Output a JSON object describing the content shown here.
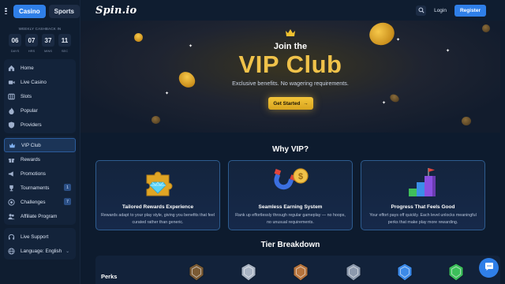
{
  "header": {
    "tabs": [
      {
        "label": "Casino",
        "active": true
      },
      {
        "label": "Sports",
        "active": false
      }
    ],
    "logo": "Spin.io",
    "login_label": "Login",
    "register_label": "Register"
  },
  "weekly_cashback": {
    "title": "WEEKLY CASHBACK IN",
    "values": [
      "06",
      "07",
      "37",
      "11"
    ],
    "labels": [
      "DAYS",
      "HRS",
      "MINS",
      "SEC"
    ]
  },
  "sidebar": {
    "group1": [
      {
        "label": "Home",
        "icon": "home-icon"
      },
      {
        "label": "Live Casino",
        "icon": "video-icon"
      },
      {
        "label": "Slots",
        "icon": "slots-icon"
      },
      {
        "label": "Popular",
        "icon": "flame-icon"
      },
      {
        "label": "Providers",
        "icon": "shield-icon"
      }
    ],
    "group2": [
      {
        "label": "VIP Club",
        "icon": "crown-icon",
        "selected": true
      },
      {
        "label": "Rewards",
        "icon": "gift-icon"
      },
      {
        "label": "Promotions",
        "icon": "megaphone-icon"
      },
      {
        "label": "Tournaments",
        "icon": "trophy-icon",
        "badge": "1"
      },
      {
        "label": "Challenges",
        "icon": "target-icon",
        "badge": "7"
      },
      {
        "label": "Affiliate Program",
        "icon": "users-icon"
      }
    ],
    "group3": [
      {
        "label": "Live Support",
        "icon": "headset-icon"
      },
      {
        "label": "Language: English",
        "icon": "globe-icon"
      }
    ]
  },
  "hero": {
    "join": "Join the",
    "vip": "VIP Club",
    "subtitle": "Exclusive benefits. No wagering requirements.",
    "cta": "Get Started",
    "cta_arrow": "→"
  },
  "why": {
    "title": "Why VIP?",
    "cards": [
      {
        "title": "Tailored Rewards Experience",
        "desc": "Rewards adapt to your play style, giving you benefits that feel curated rather than generic.",
        "icon": "puzzle-diamond-icon"
      },
      {
        "title": "Seamless Earning System",
        "desc": "Rank up effortlessly through regular gameplay — no hoops, no unusual requirements.",
        "icon": "magnet-coin-icon"
      },
      {
        "title": "Progress That Feels Good",
        "desc": "Your effort pays off quickly. Each level unlocks meaningful perks that make play more rewarding.",
        "icon": "stairs-flag-icon"
      }
    ]
  },
  "tier": {
    "title": "Tier Breakdown",
    "perks_label": "Perks",
    "badges": [
      {
        "name": "tier-badge-bronze-dim",
        "color": "#7a5a33"
      },
      {
        "name": "tier-badge-silver",
        "color": "#a9b4c4"
      },
      {
        "name": "tier-badge-bronze",
        "color": "#b5733c"
      },
      {
        "name": "tier-badge-steel",
        "color": "#8c99ad"
      },
      {
        "name": "tier-badge-sapphire",
        "color": "#3c8ae8"
      },
      {
        "name": "tier-badge-emerald",
        "color": "#3cbf5a"
      }
    ]
  },
  "colors": {
    "accent": "#2f7fe8",
    "gold": "#f0c24a",
    "background": "#0d1b2e"
  }
}
